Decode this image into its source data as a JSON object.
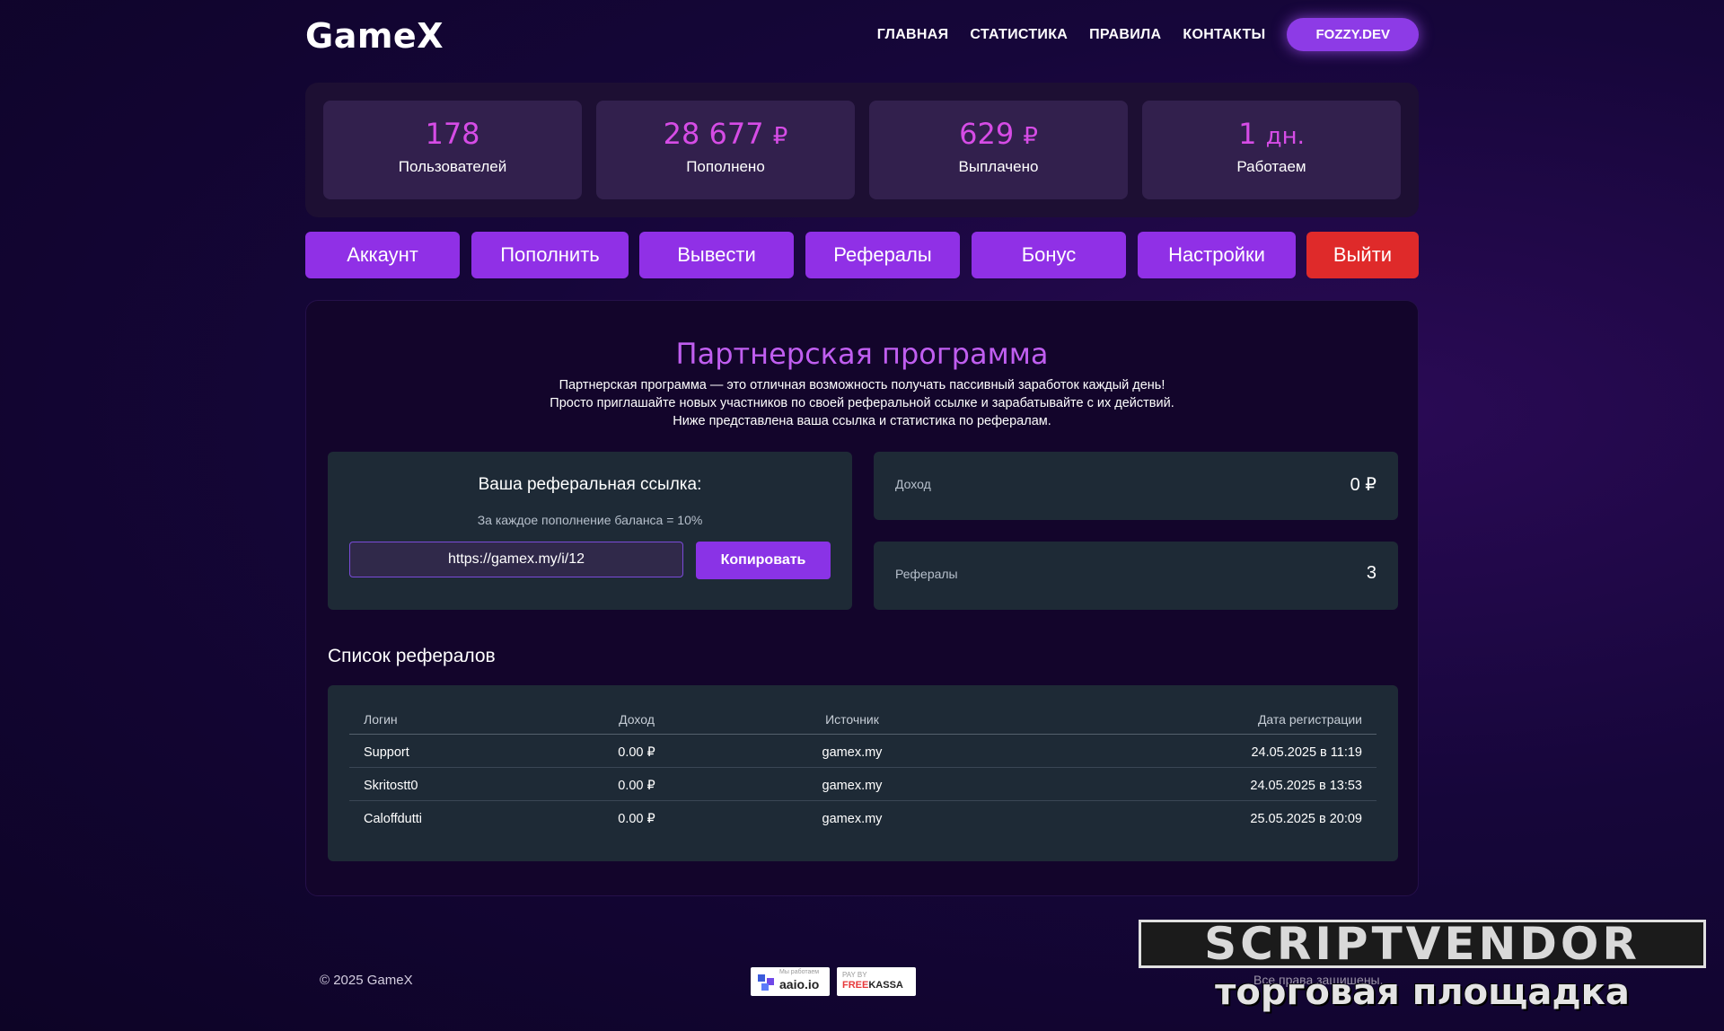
{
  "header": {
    "logo": "GameX",
    "nav": [
      "ГЛАВНАЯ",
      "СТАТИСТИКА",
      "ПРАВИЛА",
      "КОНТАКТЫ"
    ],
    "user_button": "FOZZY.DEV"
  },
  "stats": [
    {
      "value": "178",
      "unit": "",
      "label": "Пользователей"
    },
    {
      "value": "28 677",
      "unit": "₽",
      "label": "Пополнено"
    },
    {
      "value": "629",
      "unit": "₽",
      "label": "Выплачено"
    },
    {
      "value": "1",
      "unit": "дн.",
      "label": "Работаем"
    }
  ],
  "tabs": [
    "Аккаунт",
    "Пополнить",
    "Вывести",
    "Рефералы",
    "Бонус",
    "Настройки",
    "Выйти"
  ],
  "main": {
    "title": "Партнерская программа",
    "desc": [
      "Партнерская программа — это отличная возможность получать пассивный заработок каждый день!",
      "Просто приглашайте новых участников по своей реферальной ссылке и зарабатывайте с их действий.",
      "Ниже представлена ваша ссылка и статистика по рефералам."
    ],
    "ref": {
      "title": "Ваша реферальная ссылка:",
      "note": "За каждое пополнение баланса = 10%",
      "link": "https://gamex.my/i/12",
      "copy_label": "Копировать"
    },
    "income": {
      "label": "Доход",
      "value": "0 ₽"
    },
    "referrals": {
      "label": "Рефералы",
      "value": "3"
    },
    "list_title": "Список рефералов",
    "table": {
      "headers": [
        "Логин",
        "Доход",
        "Источник",
        "Дата регистрации"
      ],
      "rows": [
        [
          "Support",
          "0.00 ₽",
          "gamex.my",
          "24.05.2025 в 11:19"
        ],
        [
          "Skritostt0",
          "0.00 ₽",
          "gamex.my",
          "24.05.2025 в 13:53"
        ],
        [
          "Caloffdutti",
          "0.00 ₽",
          "gamex.my",
          "25.05.2025 в 20:09"
        ]
      ]
    }
  },
  "footer": {
    "copyright": "© 2025 GameX",
    "aaio_small": "Мы работаем",
    "aaio": "aaio.io",
    "freekassa_small": "PAY BY",
    "freekassa_free": "FREE",
    "freekassa_kassa": "KASSA",
    "rights": "Все права защищены."
  },
  "watermark": {
    "top": "SCRIPTVENDOR",
    "bottom": "торговая площадка"
  },
  "colors": {
    "accent": "#9030e6",
    "stat_value": "#d64ce6",
    "logout": "#df2a2a"
  }
}
